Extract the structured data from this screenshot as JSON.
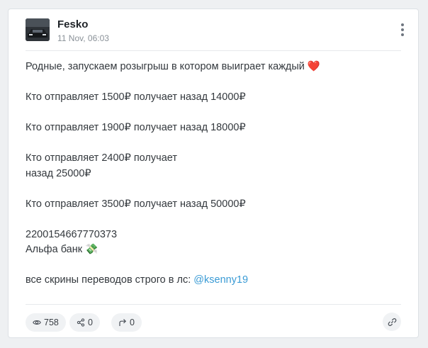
{
  "post": {
    "author": "Fesko",
    "date": "11 Nov, 06:03",
    "lines": {
      "intro": "Родные, запускаем розыгрыш в котором выиграет каждый ❤️",
      "offer1": "Кто отправляет 1500₽ получает назад 14000₽",
      "offer2": "Кто отправляет 1900₽ получает назад 18000₽",
      "offer3a": "Кто отправляет 2400₽ получает",
      "offer3b": "назад 25000₽",
      "offer4": "Кто отправляет 3500₽ получает назад 50000₽",
      "card_number": "2200154667770373",
      "bank": "Альфа банк 💸",
      "screens_prefix": "все скрины переводов строго в лс: ",
      "mention": "@ksenny19"
    }
  },
  "footer": {
    "views": "758",
    "shares": "0",
    "forwards": "0"
  },
  "icons": {
    "avatar": "car-photo-avatar",
    "menu": "more-vertical-icon",
    "views": "eye-icon",
    "shares": "share-nodes-icon",
    "forwards": "forward-arrow-icon",
    "link": "link-icon"
  },
  "colors": {
    "mention": "#3a9bd5",
    "card_bg": "#ffffff",
    "page_bg": "#eef0f2",
    "pill_bg": "#f0f2f4"
  }
}
